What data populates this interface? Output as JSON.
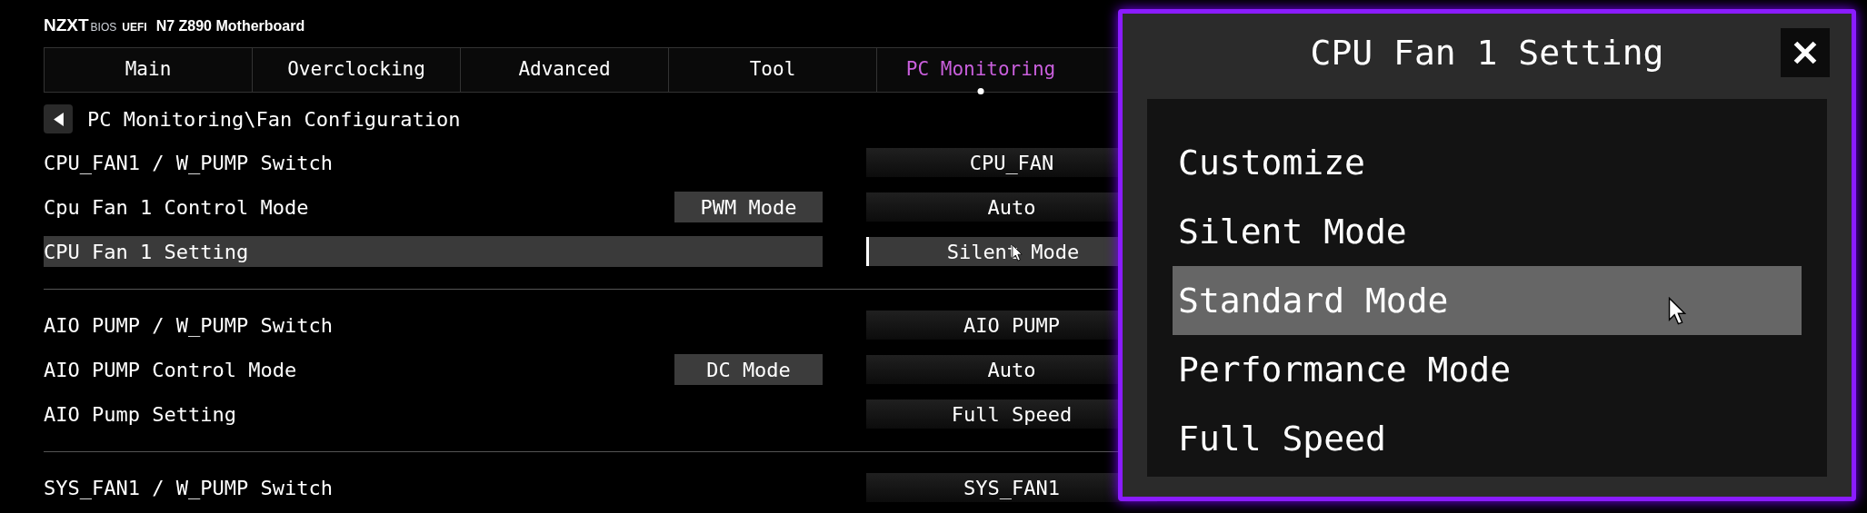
{
  "header": {
    "brand": "NZXT",
    "bios": "BIOS",
    "uefi": "UEFI",
    "model": "N7 Z890 Motherboard"
  },
  "tabs": [
    {
      "label": "Main",
      "selected": false
    },
    {
      "label": "Overclocking",
      "selected": false
    },
    {
      "label": "Advanced",
      "selected": false
    },
    {
      "label": "Tool",
      "selected": false
    },
    {
      "label": "PC Monitoring",
      "selected": true
    }
  ],
  "breadcrumb": "PC Monitoring\\Fan Configuration",
  "groups": [
    {
      "rows": [
        {
          "label": "CPU_FAN1 / W_PUMP Switch",
          "value": "CPU_FAN",
          "selected": false,
          "cursor": false
        },
        {
          "label": "Cpu Fan 1 Control Mode",
          "mode": "PWM Mode",
          "value": "Auto",
          "selected": false,
          "cursor": false
        },
        {
          "label": "CPU Fan 1 Setting",
          "value": "Silent Mode",
          "selected": true,
          "cursor": true
        }
      ]
    },
    {
      "rows": [
        {
          "label": "AIO PUMP / W_PUMP Switch",
          "value": "AIO PUMP",
          "selected": false,
          "cursor": false
        },
        {
          "label": "AIO PUMP Control Mode",
          "mode": "DC Mode",
          "value": "Auto",
          "selected": false,
          "cursor": false
        },
        {
          "label": "AIO Pump Setting",
          "value": "Full Speed",
          "selected": false,
          "cursor": false
        }
      ]
    },
    {
      "rows": [
        {
          "label": "SYS_FAN1 / W_PUMP Switch",
          "value": "SYS_FAN1",
          "selected": false,
          "cursor": false
        }
      ]
    }
  ],
  "dialog": {
    "title": "CPU Fan 1 Setting",
    "items": [
      {
        "label": "Customize",
        "selected": false
      },
      {
        "label": "Silent Mode",
        "selected": false
      },
      {
        "label": "Standard Mode",
        "selected": true
      },
      {
        "label": "Performance Mode",
        "selected": false
      },
      {
        "label": "Full Speed",
        "selected": false
      }
    ]
  }
}
